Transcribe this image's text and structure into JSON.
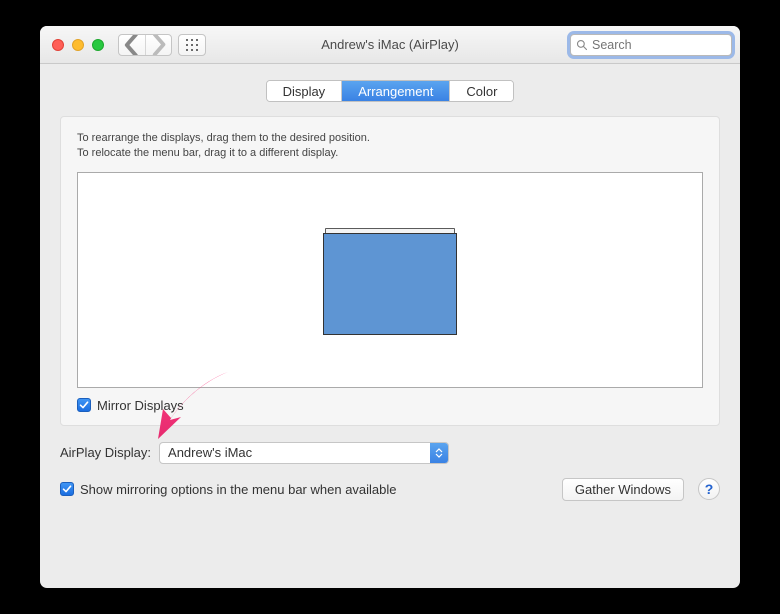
{
  "window": {
    "title": "Andrew's iMac (AirPlay)",
    "search_placeholder": "Search"
  },
  "tabs": {
    "display": "Display",
    "arrangement": "Arrangement",
    "color": "Color"
  },
  "panel": {
    "hint_line1": "To rearrange the displays, drag them to the desired position.",
    "hint_line2": "To relocate the menu bar, drag it to a different display.",
    "mirror_label": "Mirror Displays"
  },
  "footer": {
    "airplay_label": "AirPlay Display:",
    "airplay_value": "Andrew's iMac",
    "show_mirroring_label": "Show mirroring options in the menu bar when available",
    "gather_label": "Gather Windows",
    "help_label": "?"
  }
}
